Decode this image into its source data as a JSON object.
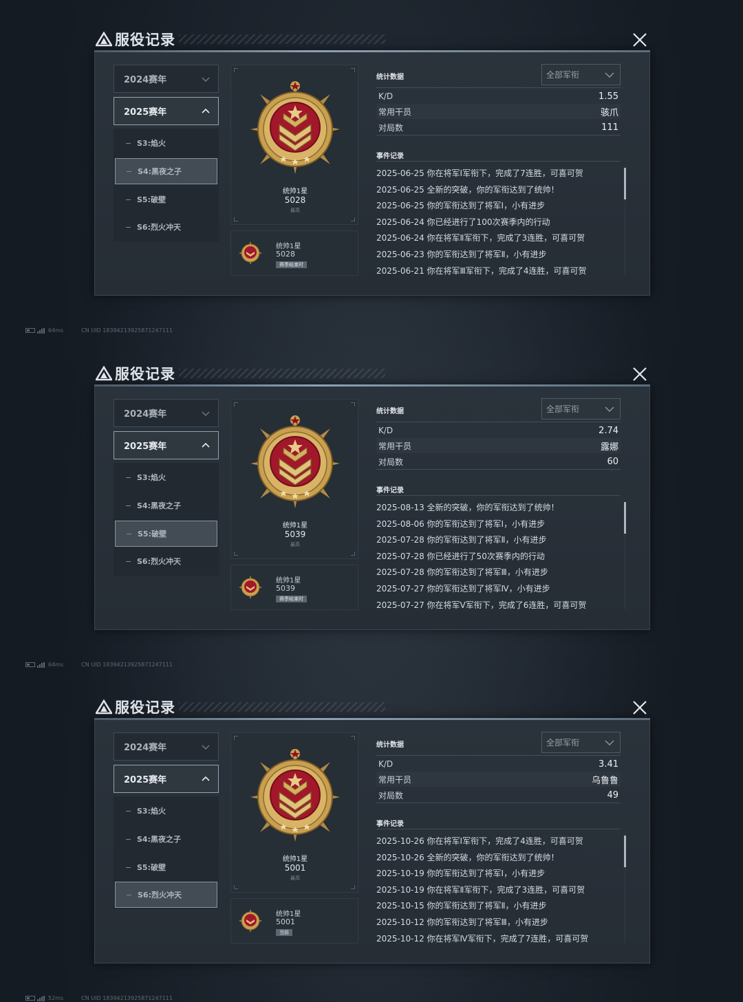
{
  "screenshots": [
    {
      "title": "服役记录",
      "seasons": [
        "2024赛年",
        "2025赛年"
      ],
      "open_season": 1,
      "sub_seasons": [
        "S3:焰火",
        "S4:黑夜之子",
        "S5:破壁",
        "S6:烈火冲天"
      ],
      "active_sub": 1,
      "rank": {
        "name": "统帅1星",
        "score": "5028",
        "tag": "最高"
      },
      "season_rank": {
        "name": "统帅1星",
        "score": "5028",
        "tag": "赛季结束时"
      },
      "stats_title": "统计数据",
      "filter": "全部军衔",
      "stats": [
        {
          "label": "K/D",
          "value": "1.55"
        },
        {
          "label": "常用干员",
          "value": "骇爪"
        },
        {
          "label": "对局数",
          "value": "111"
        }
      ],
      "events_title": "事件记录",
      "events": [
        "2025-06-25 你在将军Ⅰ军衔下，完成了7连胜，可喜可贺",
        "2025-06-25 全新的突破，你的军衔达到了统帅！",
        "2025-06-25 你的军衔达到了将军Ⅰ，小有进步",
        "2025-06-24 你已经进行了100次赛季内的行动",
        "2025-06-24 你在将军Ⅱ军衔下，完成了3连胜，可喜可贺",
        "2025-06-23 你的军衔达到了将军Ⅱ，小有进步",
        "2025-06-21 你在将军Ⅲ军衔下，完成了4连胜，可喜可贺"
      ],
      "footer": {
        "ping": "64ms",
        "uid": "CN UID 18394213925871247111"
      }
    },
    {
      "title": "服役记录",
      "seasons": [
        "2024赛年",
        "2025赛年"
      ],
      "open_season": 1,
      "sub_seasons": [
        "S3:焰火",
        "S4:黑夜之子",
        "S5:破壁",
        "S6:烈火冲天"
      ],
      "active_sub": 2,
      "rank": {
        "name": "统帅1星",
        "score": "5039",
        "tag": "最高"
      },
      "season_rank": {
        "name": "统帅1星",
        "score": "5039",
        "tag": "赛季结束时"
      },
      "stats_title": "统计数据",
      "filter": "全部军衔",
      "stats": [
        {
          "label": "K/D",
          "value": "2.74"
        },
        {
          "label": "常用干员",
          "value": "露娜"
        },
        {
          "label": "对局数",
          "value": "60"
        }
      ],
      "events_title": "事件记录",
      "events": [
        "2025-08-13 全新的突破，你的军衔达到了统帅！",
        "2025-08-06 你的军衔达到了将军Ⅰ，小有进步",
        "2025-07-28 你的军衔达到了将军Ⅱ，小有进步",
        "2025-07-28 你已经进行了50次赛季内的行动",
        "2025-07-28 你的军衔达到了将军Ⅲ，小有进步",
        "2025-07-27 你的军衔达到了将军Ⅳ，小有进步",
        "2025-07-27 你在将军Ⅴ军衔下，完成了6连胜，可喜可贺"
      ],
      "footer": {
        "ping": "64ms",
        "uid": "CN UID 18394213925871247111"
      }
    },
    {
      "title": "服役记录",
      "seasons": [
        "2024赛年",
        "2025赛年"
      ],
      "open_season": 1,
      "sub_seasons": [
        "S3:焰火",
        "S4:黑夜之子",
        "S5:破壁",
        "S6:烈火冲天"
      ],
      "active_sub": 3,
      "rank": {
        "name": "统帅1星",
        "score": "5001",
        "tag": "最高"
      },
      "season_rank": {
        "name": "统帅1星",
        "score": "5001",
        "tag": "当前"
      },
      "stats_title": "统计数据",
      "filter": "全部军衔",
      "stats": [
        {
          "label": "K/D",
          "value": "3.41"
        },
        {
          "label": "常用干员",
          "value": "乌鲁鲁"
        },
        {
          "label": "对局数",
          "value": "49"
        }
      ],
      "events_title": "事件记录",
      "events": [
        "2025-10-26 你在将军Ⅰ军衔下，完成了4连胜，可喜可贺",
        "2025-10-26 全新的突破，你的军衔达到了统帅！",
        "2025-10-19 你的军衔达到了将军Ⅰ，小有进步",
        "2025-10-19 你在将军Ⅱ军衔下，完成了3连胜，可喜可贺",
        "2025-10-15 你的军衔达到了将军Ⅱ，小有进步",
        "2025-10-12 你的军衔达到了将军Ⅲ，小有进步",
        "2025-10-12 你在将军Ⅳ军衔下，完成了7连胜，可喜可贺"
      ],
      "footer": {
        "ping": "52ms",
        "uid": "CN UID 18394213925871247111"
      }
    }
  ],
  "colors": {
    "medal_gold": "#c9a050",
    "medal_red": "#a3172a",
    "accent": "#8fa2b3"
  }
}
